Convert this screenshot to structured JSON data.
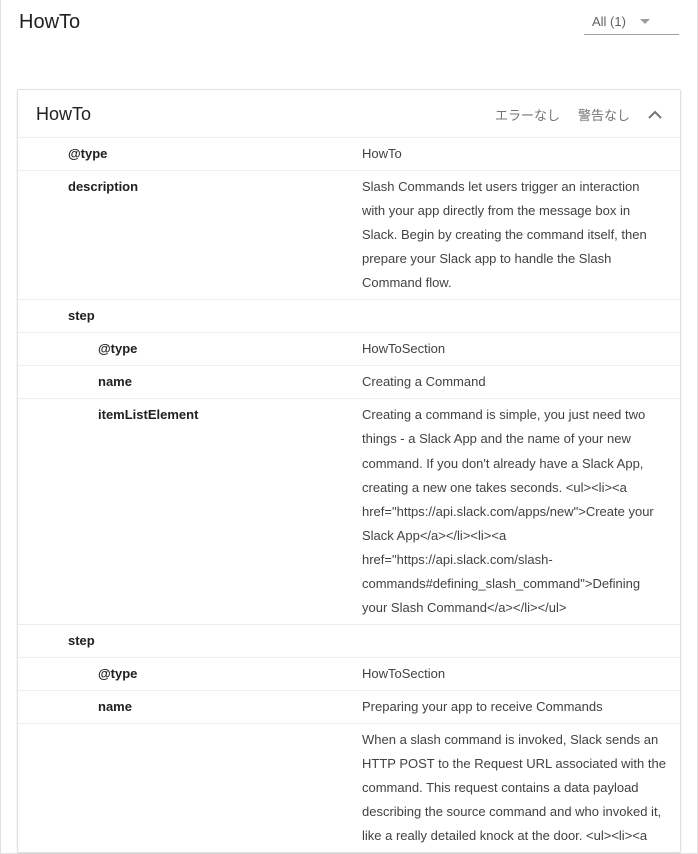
{
  "header": {
    "title": "HowTo",
    "filter_label": "All (1)"
  },
  "card": {
    "title": "HowTo",
    "status_error": "エラーなし",
    "status_warn": "警告なし"
  },
  "rows": [
    {
      "key": "@type",
      "value": "HowTo",
      "indent": 1
    },
    {
      "key": "description",
      "value": "Slash Commands let users trigger an interaction with your app directly from the message box in Slack. Begin by creating the command itself, then prepare your Slack app to handle the Slash Command flow.",
      "indent": 1
    },
    {
      "key": "step",
      "value": "",
      "indent": 1
    },
    {
      "key": "@type",
      "value": "HowToSection",
      "indent": 2
    },
    {
      "key": "name",
      "value": "Creating a Command",
      "indent": 2
    },
    {
      "key": "itemListElement",
      "value": "Creating a command is simple, you just need two things - a Slack App and the name of your new command. If you don't already have a Slack App, creating a new one takes seconds. <ul><li><a href=\"https://api.slack.com/apps/new\">Create your Slack App</a></li><li><a href=\"https://api.slack.com/slash-commands#defining_slash_command\">Defining your Slash Command</a></li></ul>",
      "indent": 2
    },
    {
      "key": "step",
      "value": "",
      "indent": 1
    },
    {
      "key": "@type",
      "value": "HowToSection",
      "indent": 2
    },
    {
      "key": "name",
      "value": "Preparing your app to receive Commands",
      "indent": 2
    },
    {
      "key": "",
      "value": "When a slash command is invoked, Slack sends an HTTP POST to the Request URL associated with the command. This request contains a data payload describing the source command and who invoked it, like a really detailed knock at the door. <ul><li><a",
      "indent": 2
    }
  ]
}
